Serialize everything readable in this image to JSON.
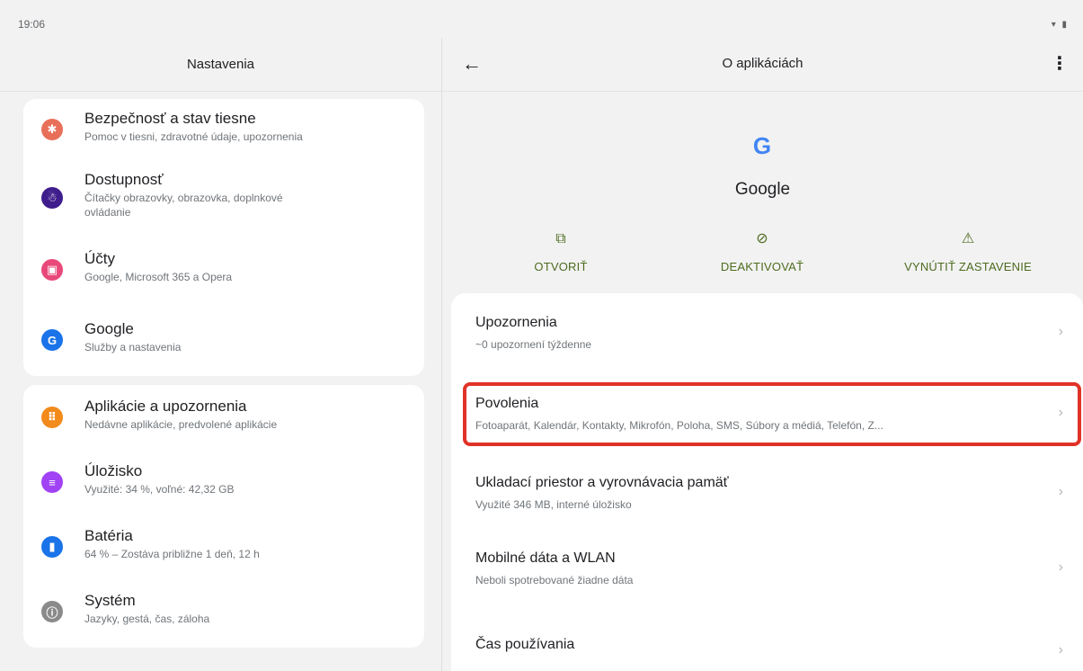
{
  "status": {
    "time": "19:06",
    "icons": "▾ ▮"
  },
  "left": {
    "title": "Nastavenia",
    "items": [
      {
        "title": "Bezpečnosť a stav tiesne",
        "subtitle": "Pomoc v tiesni, zdravotné údaje, upozornenia",
        "icon": "asterisk-icon",
        "color": "#e8705a"
      },
      {
        "title": "Dostupnosť",
        "subtitle": "Čítačky obrazovky, obrazovka, doplnkové ovládanie",
        "icon": "accessibility-icon",
        "color": "#3f1d8c"
      },
      {
        "title": "Účty",
        "subtitle": "Google, Microsoft 365 a Opera",
        "icon": "account-icon",
        "color": "#e8497a"
      },
      {
        "title": "Google",
        "subtitle": "Služby a nastavenia",
        "icon": "google-icon",
        "color": "#1a73e8"
      },
      {
        "title": "Aplikácie a upozornenia",
        "subtitle": "Nedávne aplikácie, predvolené aplikácie",
        "icon": "apps-icon",
        "color": "#f28b1c"
      },
      {
        "title": "Úložisko",
        "subtitle": "Využité: 34 %, voľné: 42,32 GB",
        "icon": "storage-icon",
        "color": "#a142f4"
      },
      {
        "title": "Batéria",
        "subtitle": "64 % – Zostáva približne 1 deň, 12 h",
        "icon": "battery-icon",
        "color": "#1a73e8"
      },
      {
        "title": "Systém",
        "subtitle": "Jazyky, gestá, čas, záloha",
        "icon": "info-icon",
        "color": "#8a8a8a"
      }
    ]
  },
  "right": {
    "title": "O aplikáciách",
    "app_name": "Google",
    "actions": [
      {
        "label": "OTVORIŤ",
        "icon": "open-icon"
      },
      {
        "label": "DEAKTIVOVAŤ",
        "icon": "disable-icon"
      },
      {
        "label": "VYNÚTIŤ ZASTAVENIE",
        "icon": "warning-icon"
      }
    ],
    "rows": [
      {
        "title": "Upozornenia",
        "subtitle": "~0 upozornení týždenne"
      },
      {
        "title": "Povolenia",
        "subtitle": "Fotoaparát, Kalendár, Kontakty, Mikrofón, Poloha, SMS, Súbory a médiá, Telefón, Z..."
      },
      {
        "title": "Ukladací priestor a vyrovnávacia pamäť",
        "subtitle": "Využité 346 MB, interné úložisko"
      },
      {
        "title": "Mobilné dáta a WLAN",
        "subtitle": "Neboli spotrebované žiadne dáta"
      },
      {
        "title": "Čas používania",
        "subtitle": ""
      }
    ],
    "accent": "#4d6b1f",
    "highlight_color": "#e13227"
  }
}
